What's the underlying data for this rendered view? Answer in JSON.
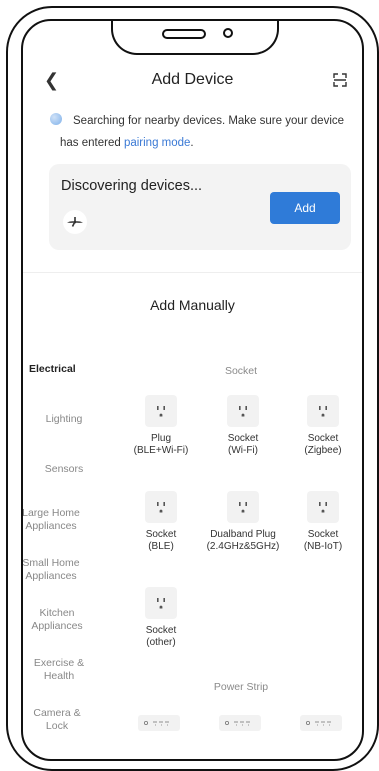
{
  "header": {
    "title": "Add Device"
  },
  "hint": {
    "text": "Searching for nearby devices. Make sure your device has entered ",
    "link": "pairing mode",
    "suffix": "."
  },
  "discovery": {
    "title": "Discovering devices...",
    "add_label": "Add"
  },
  "manual": {
    "title": "Add Manually"
  },
  "categories": [
    "Electrical",
    "Lighting",
    "Sensors",
    "Large Home Appliances",
    "Small Home Appliances",
    "Kitchen Appliances",
    "Exercise & Health",
    "Camera & Lock"
  ],
  "groups": [
    {
      "title": "Socket",
      "devices": [
        "Plug\n(BLE+Wi-Fi)",
        "Socket\n(Wi-Fi)",
        "Socket\n(Zigbee)",
        "Socket\n(BLE)",
        "Dualband Plug\n(2.4GHz&5GHz)",
        "Socket\n(NB-IoT)",
        "Socket\n(other)"
      ]
    },
    {
      "title": "Power Strip",
      "devices": []
    }
  ],
  "colors": {
    "accent": "#2f7bd8",
    "link": "#3a79d5",
    "card": "#f3f3f3"
  }
}
